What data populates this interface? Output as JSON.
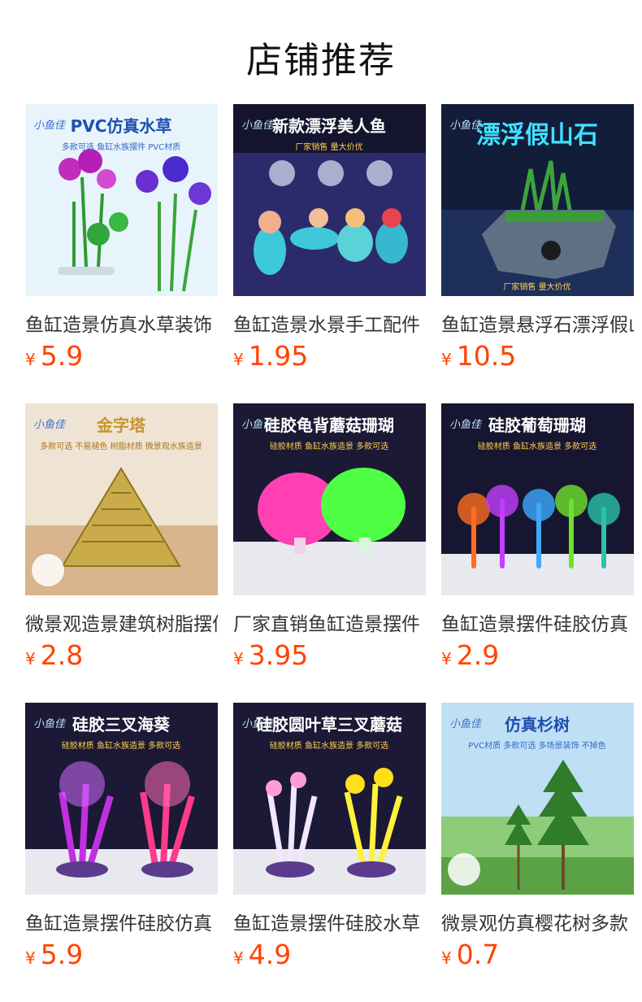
{
  "header": {
    "title": "店铺推荐"
  },
  "currency": "¥",
  "products": [
    {
      "name": "鱼缸造景仿真水草装饰",
      "price": "5.9",
      "thumb_text": "PVC仿真水草",
      "thumb_sub": "多款可选 鱼缸水族摆件 PVC材质",
      "logo": "小鱼佳",
      "bg": "#e8f4fb"
    },
    {
      "name": "鱼缸造景水景手工配件",
      "price": "1.95",
      "thumb_text": "新款漂浮美人鱼",
      "thumb_sub": "厂家销售 量大价优",
      "logo": "小鱼佳",
      "bg": "#14142e"
    },
    {
      "name": "鱼缸造景悬浮石漂浮假山石",
      "price": "10.5",
      "thumb_text": "漂浮假山石",
      "thumb_sub": "厂家销售 量大价优",
      "logo": "小鱼佳",
      "bg": "#121d3a"
    },
    {
      "name": "微景观造景建筑树脂摆件",
      "price": "2.8",
      "thumb_text": "金字塔",
      "thumb_sub": "多款可选 不易褪色 树脂材质 微景观水族造景",
      "logo": "小鱼佳",
      "bg": "#efe4d3"
    },
    {
      "name": "厂家直销鱼缸造景摆件",
      "price": "3.95",
      "thumb_text": "硅胶龟背蘑菇珊瑚",
      "thumb_sub": "硅胶材质 鱼缸水族造景 多款可选",
      "logo": "小鱼佳",
      "bg": "#1b1933"
    },
    {
      "name": "鱼缸造景摆件硅胶仿真",
      "price": "2.9",
      "thumb_text": "硅胶葡萄珊瑚",
      "thumb_sub": "硅胶材质 鱼缸水族造景 多款可选",
      "logo": "小鱼佳",
      "bg": "#171630"
    },
    {
      "name": "鱼缸造景摆件硅胶仿真",
      "price": "5.9",
      "thumb_text": "硅胶三叉海葵",
      "thumb_sub": "硅胶材质 鱼缸水族造景 多款可选",
      "logo": "小鱼佳",
      "bg": "#1b1935"
    },
    {
      "name": "鱼缸造景摆件硅胶水草",
      "price": "4.9",
      "thumb_text": "硅胶圆叶草三叉蘑菇",
      "thumb_sub": "硅胶材质 鱼缸水族造景 多款可选",
      "logo": "小鱼佳",
      "bg": "#1b1935"
    },
    {
      "name": "微景观仿真樱花树多款",
      "price": "0.7",
      "thumb_text": "仿真杉树",
      "thumb_sub": "PVC材质 多款可选 多场景装饰 不掉色",
      "logo": "小鱼佳",
      "bg": "#bfe0f4"
    }
  ]
}
